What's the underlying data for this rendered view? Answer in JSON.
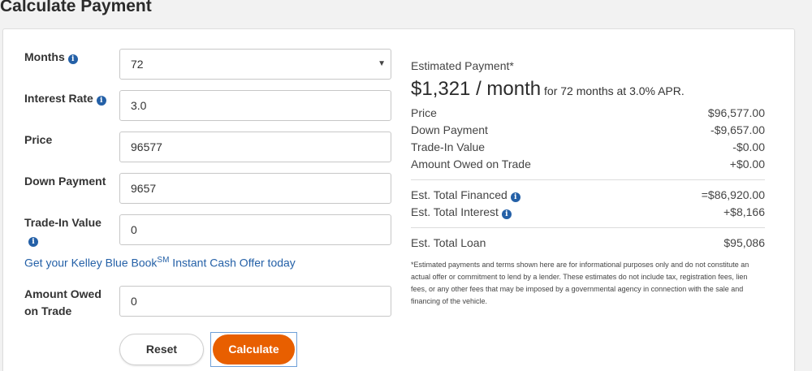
{
  "page": {
    "title": "Calculate Payment"
  },
  "form": {
    "months": {
      "label": "Months",
      "value": "72"
    },
    "interest_rate": {
      "label": "Interest Rate",
      "value": "3.0"
    },
    "price": {
      "label": "Price",
      "value": "96577"
    },
    "down_payment": {
      "label": "Down Payment",
      "value": "9657"
    },
    "trade_in": {
      "label": "Trade-In Value",
      "value": "0"
    },
    "amount_owed": {
      "label_line1": "Amount Owed",
      "label_line2": "on Trade",
      "value": "0"
    },
    "kbb_link": {
      "prefix": "Get your Kelley Blue Book",
      "sup": "SM",
      "suffix": " Instant Cash Offer today"
    },
    "reset_label": "Reset",
    "calculate_label": "Calculate"
  },
  "summary": {
    "estimated_label": "Estimated Payment*",
    "payment_amount": "$1,321 / month",
    "payment_detail": " for 72 months at 3.0% APR.",
    "rows": [
      {
        "label": "Price",
        "value": "$96,577.00"
      },
      {
        "label": "Down Payment",
        "value": "-$9,657.00"
      },
      {
        "label": "Trade-In Value",
        "value": "-$0.00"
      },
      {
        "label": "Amount Owed on Trade",
        "value": "+$0.00"
      }
    ],
    "total_financed": {
      "label": "Est. Total Financed",
      "value": "=$86,920.00"
    },
    "total_interest": {
      "label": "Est. Total Interest",
      "value": "+$8,166"
    },
    "total_loan": {
      "label": "Est. Total Loan",
      "value": "$95,086"
    },
    "disclaimer": "*Estimated payments and terms shown here are for informational purposes only and do not constitute an actual offer or commitment to lend by a lender. These estimates do not include tax, registration fees, lien fees, or any other fees that may be imposed by a governmental agency in connection with the sale and financing of the vehicle."
  },
  "colors": {
    "accent": "#e85f00",
    "link": "#2460a7",
    "info_icon": "#2460a7"
  }
}
